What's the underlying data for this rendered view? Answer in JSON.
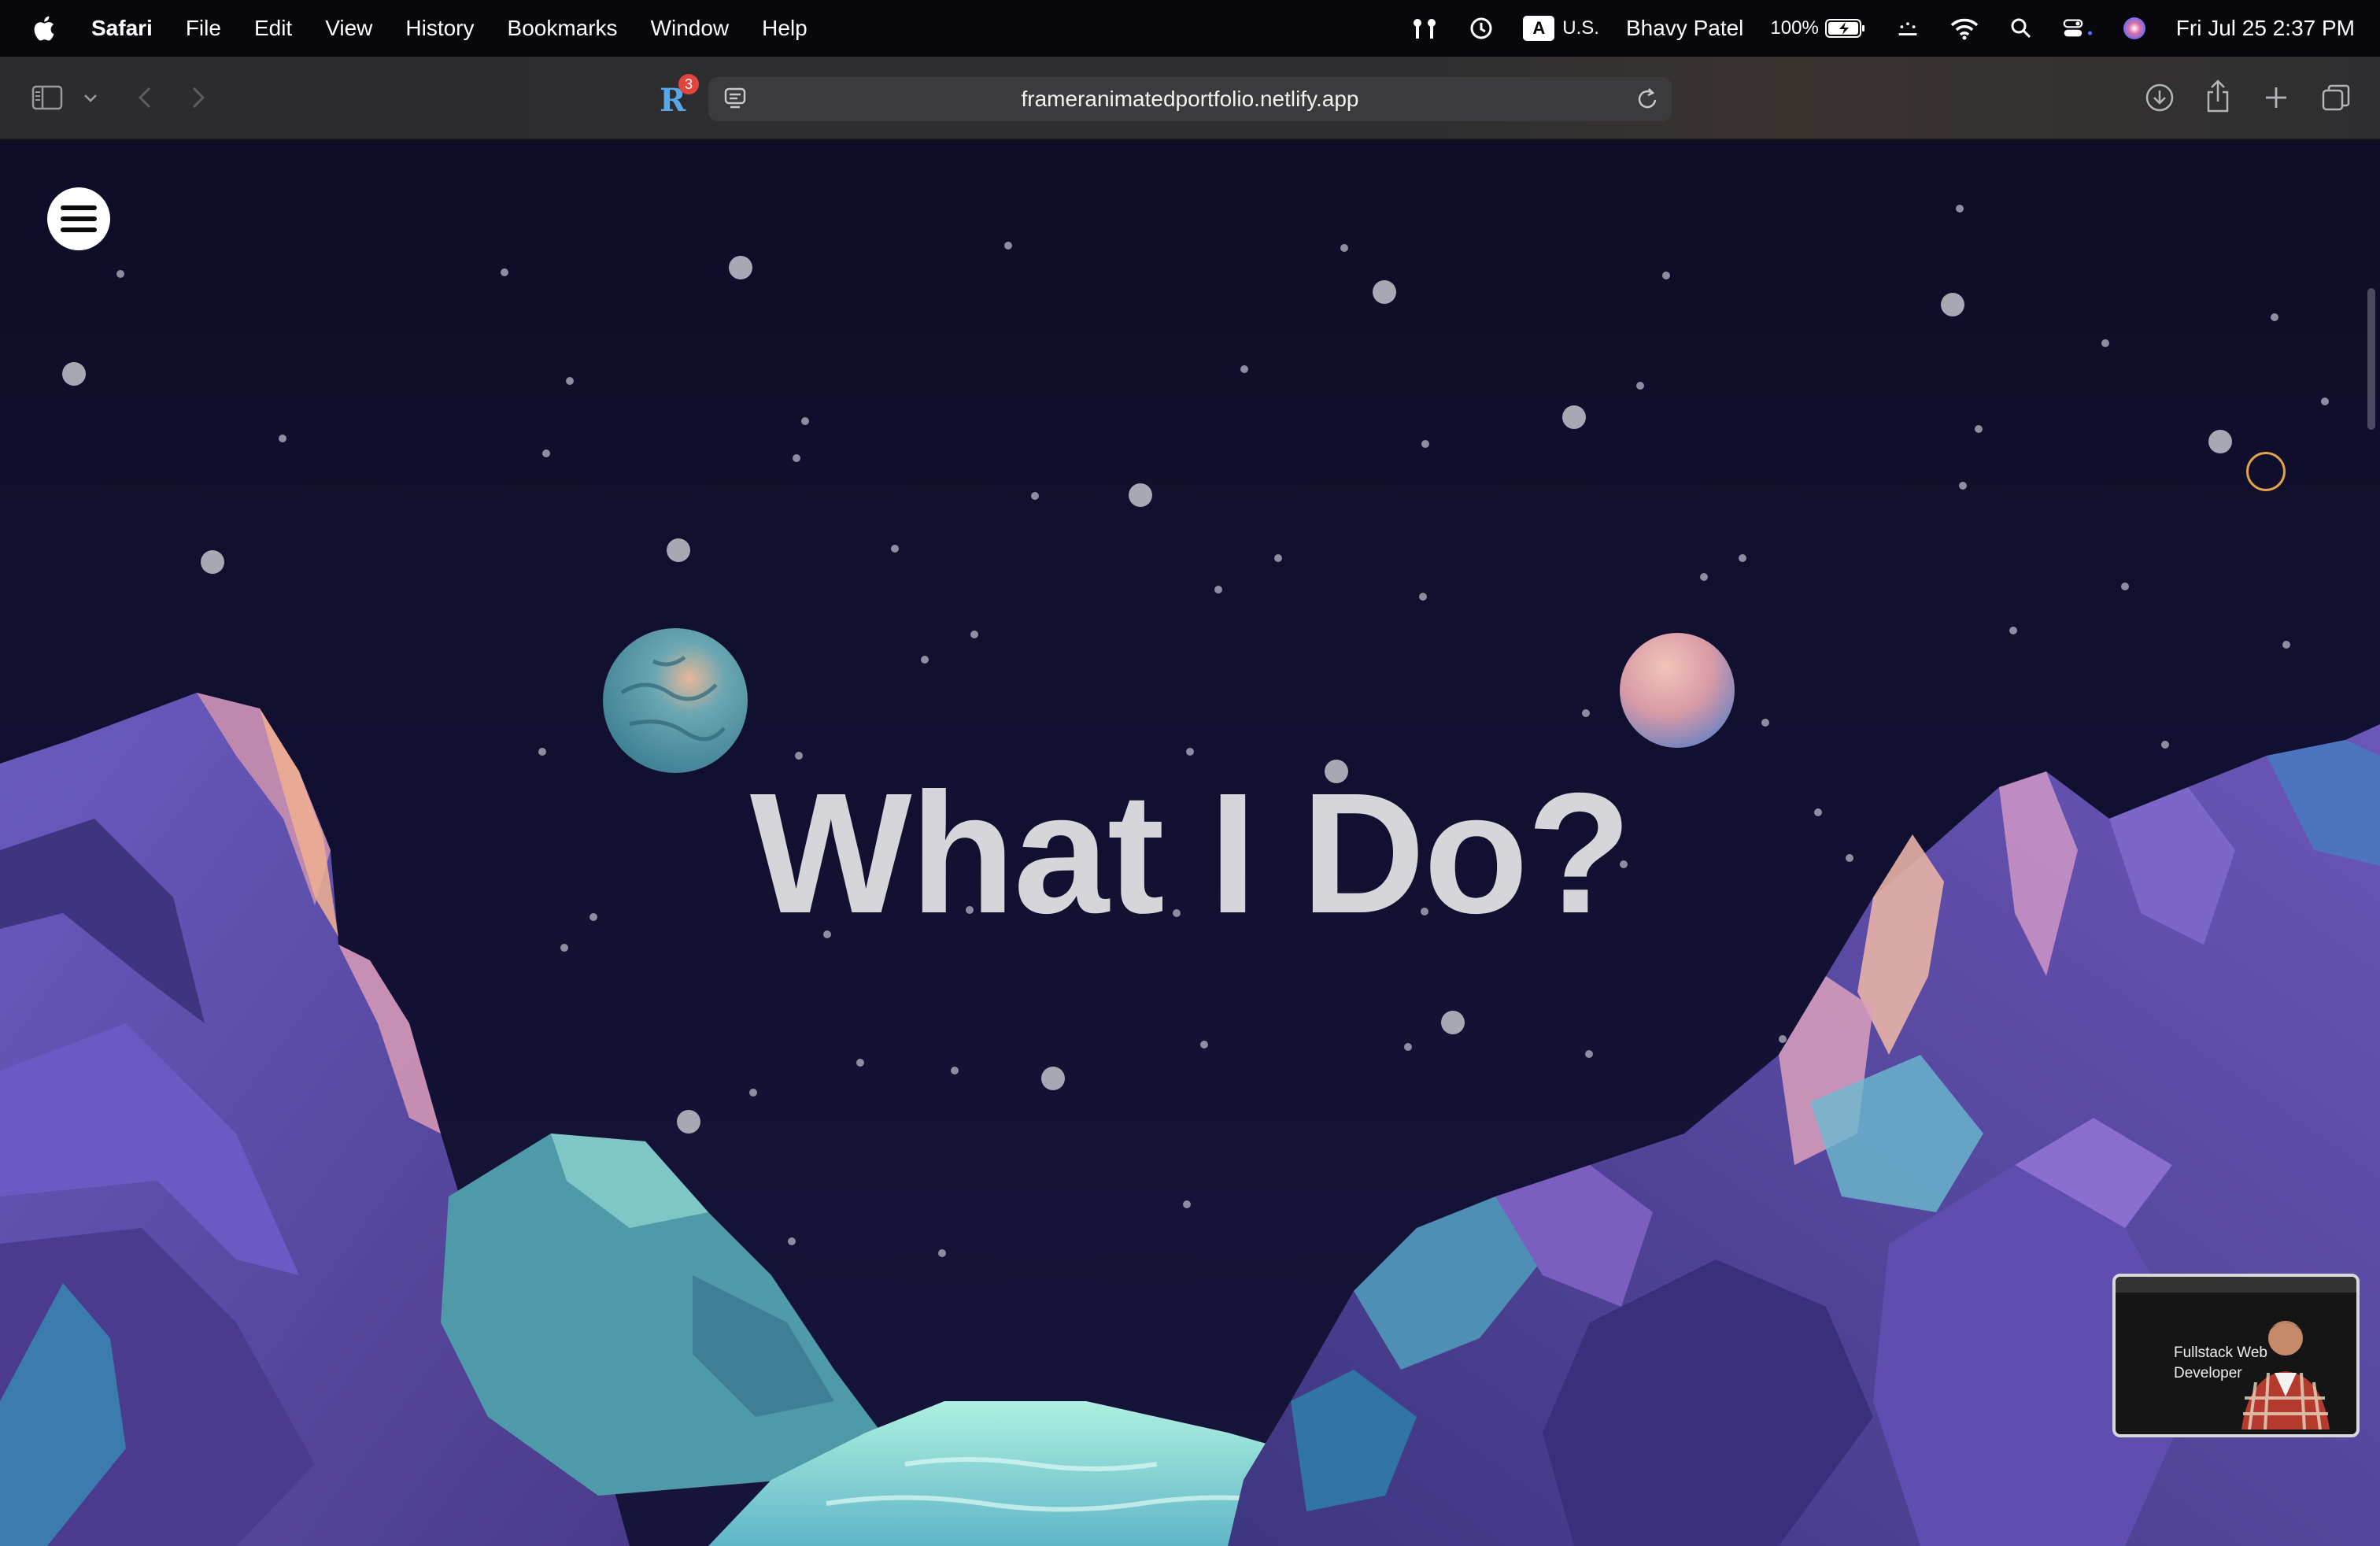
{
  "menubar": {
    "app_name": "Safari",
    "items": [
      "File",
      "Edit",
      "View",
      "History",
      "Bookmarks",
      "Window",
      "Help"
    ],
    "input_source_letter": "A",
    "input_source": "U.S.",
    "user_name": "Bhavy Patel",
    "battery": "100%",
    "datetime": "Fri Jul 25  2:37 PM",
    "icons": [
      "airplay-icon",
      "time-machine-icon",
      "wifi-icon",
      "search-icon",
      "control-center-icon",
      "siri-icon"
    ]
  },
  "toolbar": {
    "url": "frameranimatedportfolio.netlify.app",
    "extension_letter": "R",
    "extension_badge": "3"
  },
  "page": {
    "headline": "What I Do?"
  },
  "pip": {
    "title": "Fullstack Web Developer"
  },
  "colors": {
    "sky": "#100f2b",
    "headline": "#d6d6da",
    "accent_link": "#5aa7e6"
  }
}
